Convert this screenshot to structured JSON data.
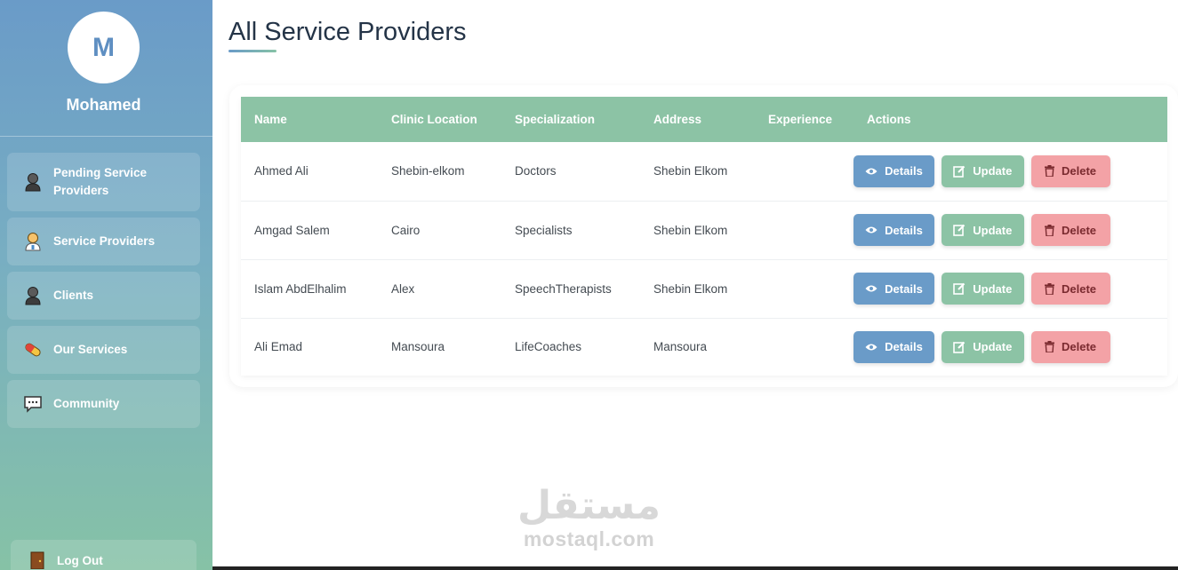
{
  "sidebar": {
    "avatar_initial": "M",
    "username": "Mohamed",
    "items": [
      {
        "label": "Pending Service Providers",
        "icon": "person-dark-icon"
      },
      {
        "label": "Service Providers",
        "icon": "health-worker-icon"
      },
      {
        "label": "Clients",
        "icon": "person-dark-icon"
      },
      {
        "label": "Our Services",
        "icon": "pill-icon"
      },
      {
        "label": "Community",
        "icon": "speech-bubble-icon"
      }
    ],
    "logout_label": "Log Out"
  },
  "main": {
    "title": "All Service Providers"
  },
  "table": {
    "headers": [
      "Name",
      "Clinic Location",
      "Specialization",
      "Address",
      "Experience",
      "Actions"
    ],
    "rows": [
      {
        "name": "Ahmed Ali",
        "location": "Shebin-elkom",
        "specialization": "Doctors",
        "address": "Shebin Elkom",
        "experience": ""
      },
      {
        "name": "Amgad Salem",
        "location": "Cairo",
        "specialization": "Specialists",
        "address": "Shebin Elkom",
        "experience": ""
      },
      {
        "name": "Islam AbdElhalim",
        "location": "Alex",
        "specialization": "SpeechTherapists",
        "address": "Shebin Elkom",
        "experience": ""
      },
      {
        "name": "Ali Emad",
        "location": "Mansoura",
        "specialization": "LifeCoaches",
        "address": "Mansoura",
        "experience": ""
      }
    ],
    "actions": {
      "details": "Details",
      "update": "Update",
      "delete": "Delete"
    }
  },
  "watermark": {
    "arabic": "مستقل",
    "latin": "mostaql.com"
  },
  "colors": {
    "primary": "#6a9bc8",
    "secondary": "#8cc3a5",
    "danger": "#f3a2a6"
  }
}
